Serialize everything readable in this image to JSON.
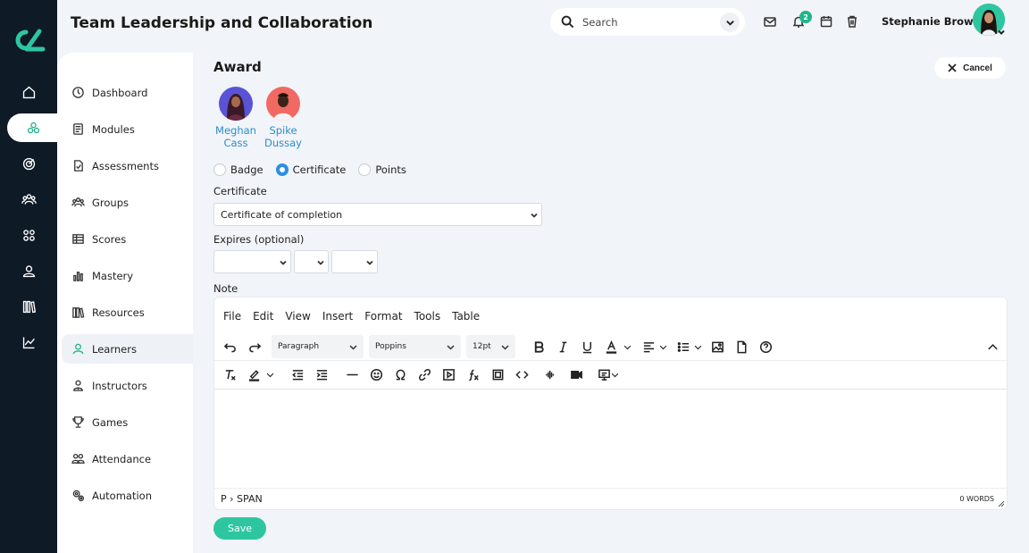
{
  "header": {
    "title": "Team Leadership and Collaboration",
    "search_placeholder": "Search",
    "notification_count": "2",
    "user_name": "Stephanie Brown"
  },
  "rail": {
    "icons": [
      "home-icon",
      "modules-icon",
      "target-icon",
      "groups-icon",
      "apps-icon",
      "user-icon",
      "library-icon",
      "chart-icon"
    ],
    "accent": "#1fb58d"
  },
  "subnav": {
    "items": [
      {
        "label": "Dashboard",
        "icon": "dashboard-icon"
      },
      {
        "label": "Modules",
        "icon": "modules-icon"
      },
      {
        "label": "Assessments",
        "icon": "assessments-icon"
      },
      {
        "label": "Groups",
        "icon": "groups-icon"
      },
      {
        "label": "Scores",
        "icon": "scores-icon"
      },
      {
        "label": "Mastery",
        "icon": "mastery-icon"
      },
      {
        "label": "Resources",
        "icon": "resources-icon"
      },
      {
        "label": "Learners",
        "icon": "learners-icon",
        "active": true
      },
      {
        "label": "Instructors",
        "icon": "instructors-icon"
      },
      {
        "label": "Games",
        "icon": "games-icon"
      },
      {
        "label": "Attendance",
        "icon": "attendance-icon"
      },
      {
        "label": "Automation",
        "icon": "automation-icon"
      }
    ]
  },
  "award": {
    "title": "Award",
    "cancel_label": "Cancel",
    "learners": [
      {
        "first": "Meghan",
        "last": "Cass"
      },
      {
        "first": "Spike",
        "last": "Dussay"
      }
    ],
    "types": [
      "Badge",
      "Certificate",
      "Points"
    ],
    "selected_type": "Certificate",
    "certificate_label": "Certificate",
    "certificate_value": "Certificate of completion",
    "expires_label": "Expires (optional)",
    "note_label": "Note",
    "save_label": "Save"
  },
  "editor": {
    "menu": [
      "File",
      "Edit",
      "View",
      "Insert",
      "Format",
      "Tools",
      "Table"
    ],
    "block_format": "Paragraph",
    "font_family": "Poppins",
    "font_size": "12pt",
    "path": "P › SPAN",
    "word_count": "0 WORDS"
  }
}
